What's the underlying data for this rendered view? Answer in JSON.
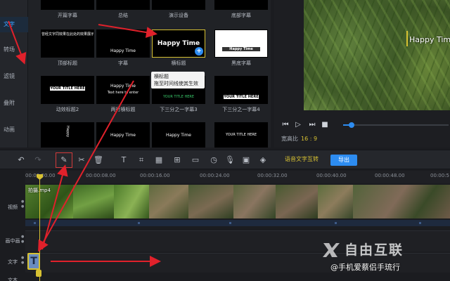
{
  "sidebar": {
    "items": [
      {
        "label": "文字",
        "active": true
      },
      {
        "label": "转场",
        "active": false
      },
      {
        "label": "滤镜",
        "active": false
      },
      {
        "label": "叠附",
        "active": false
      },
      {
        "label": "动画",
        "active": false
      }
    ]
  },
  "templates": [
    {
      "caption": "开篇字幕"
    },
    {
      "caption": "总结"
    },
    {
      "caption": "演示设备"
    },
    {
      "caption": "底部字幕"
    },
    {
      "caption": "顶部标题",
      "text": "曾经文字同效果在此处的效果展示"
    },
    {
      "caption": "字幕",
      "text": "Happy Time"
    },
    {
      "caption": "横标题",
      "text": "Happy Time",
      "selected": true,
      "add_icon": "+"
    },
    {
      "caption": "黑底字幕",
      "text": "Happy Time"
    },
    {
      "caption": "动效标题2",
      "text": "YOUR TITLE HERE"
    },
    {
      "caption": "两行横标题",
      "text": "Happy Time",
      "text2": "Text here to enter"
    },
    {
      "caption": "下三分之一字幕3",
      "text": "YOUR TITLE HERE"
    },
    {
      "caption": "下三分之一字幕4",
      "text": "YOUR TITLE HERE"
    },
    {
      "caption": "",
      "text": "Happy"
    },
    {
      "caption": "",
      "text": "Happy Time"
    },
    {
      "caption": "",
      "text": "Happy Time"
    },
    {
      "caption": "",
      "text": "YOUR TITLE HERE"
    }
  ],
  "tooltip": {
    "line1": "横标题",
    "line2": "拖至时间线使其生效"
  },
  "preview": {
    "caption": "Happy Time",
    "aspect_label": "宽高比",
    "aspect_value": "16 : 9",
    "progress": 0.08,
    "controls": {
      "prev": "⏮",
      "play": "▷",
      "next": "⏭",
      "stop": "■"
    }
  },
  "toolbar": {
    "icons": [
      "undo-icon",
      "redo-icon",
      "edit-icon",
      "cut-icon",
      "delete-icon",
      "text-icon",
      "crop-icon",
      "mosaic-icon",
      "freeze-icon",
      "zoom-icon",
      "speed-icon",
      "voiceover-icon",
      "screenshot-icon",
      "color-icon"
    ],
    "speech_label": "语音文字互转",
    "export_label": "导出"
  },
  "timeline": {
    "ticks": [
      "00:00:00.00",
      "00:00:08.00",
      "00:00:16.00",
      "00:00:24.00",
      "00:00:32.00",
      "00:00:40.00",
      "00:00:48.00",
      "00:00:5"
    ],
    "tracks": {
      "video": "视频",
      "pip": "画中画",
      "text": "文字",
      "audio": "文本"
    },
    "clip_name": "拍摄.mp4",
    "text_clip_icon": "T"
  },
  "watermark": {
    "brand": "自由互联",
    "author": "@手机爱蔡侣手琉行"
  },
  "colors": {
    "accent": "#2d8cf0",
    "highlight": "#d7c132",
    "annotation": "#e0212b"
  }
}
